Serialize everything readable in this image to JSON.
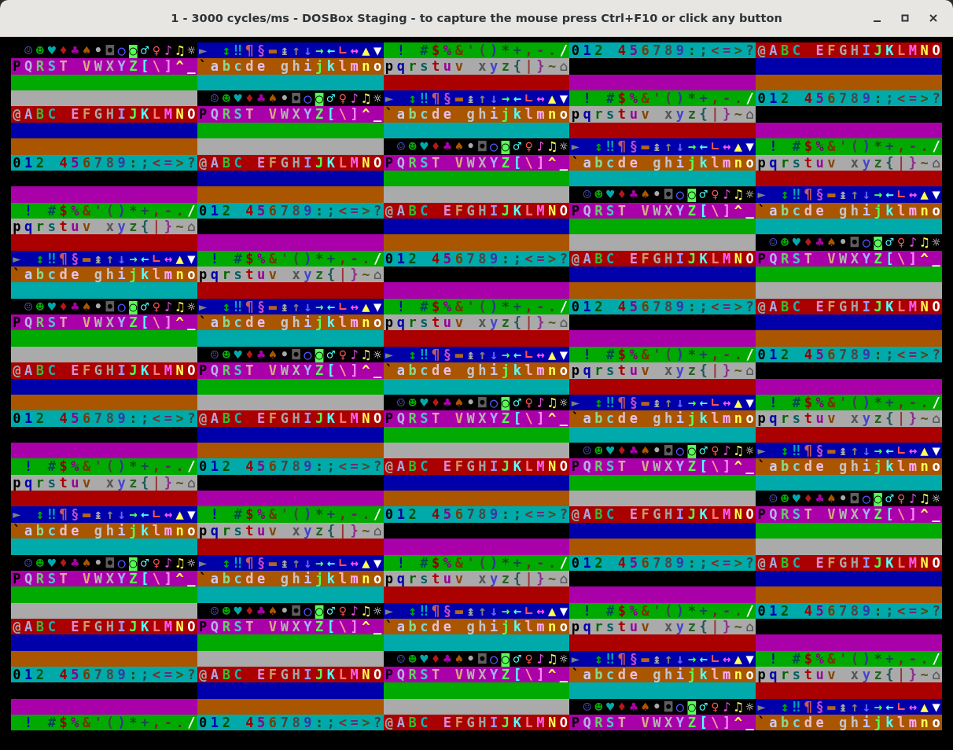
{
  "window": {
    "title": "1 - 3000 cycles/ms - DOSBox Staging - to capture the mouse press Ctrl+F10 or click any button"
  },
  "screen": {
    "rows": [
      [
        {
          "text": " ☺☻♥♦♣♠•◘○◙♂♀♪♫☼",
          "color": "#000000"
        },
        {
          "text": "► ↕‼¶§▬↨↑↓→←∟↔▲▼",
          "color": "#0000aa"
        },
        {
          "text": " ! #$%&'()*+,-./",
          "color": "#00aa00"
        },
        {
          "text": "012 456789:;<=>?",
          "color": "#00aaaa"
        },
        {
          "text": "@ABC EFGHIJKLMNO",
          "color": "#aa0000"
        }
      ],
      [
        {
          "text": "PQRST VWXYZ[\\]^_",
          "color": "#aa00aa"
        },
        {
          "text": "`abcde ghijklmno",
          "color": "#aa5500"
        },
        {
          "text": "pqrstuv xyz{|}~⌂",
          "color": "#aaaaaa"
        },
        {
          "color": "#000000"
        },
        {
          "color": "#0000aa"
        }
      ],
      [
        {
          "color": "#00aa00"
        },
        {
          "color": "#00aaaa"
        },
        {
          "color": "#aa0000"
        },
        {
          "color": "#aa00aa"
        },
        {
          "color": "#aa5500"
        }
      ],
      [
        {
          "color": "#aaaaaa"
        },
        {
          "text": " ☺☻♥♦♣♠•◘○◙♂♀♪♫☼",
          "color": "#000000"
        },
        {
          "text": "► ↕‼¶§▬↨↑↓→←∟↔▲▼",
          "color": "#0000aa"
        },
        {
          "text": " ! #$%&'()*+,-./",
          "color": "#00aa00"
        },
        {
          "text": "012 456789:;<=>?",
          "color": "#00aaaa"
        }
      ],
      [
        {
          "text": "@ABC EFGHIJKLMNO",
          "color": "#aa0000"
        },
        {
          "text": "PQRST VWXYZ[\\]^_",
          "color": "#aa00aa"
        },
        {
          "text": "`abcde ghijklmno",
          "color": "#aa5500"
        },
        {
          "text": "pqrstuv xyz{|}~⌂",
          "color": "#aaaaaa"
        },
        {
          "color": "#000000"
        }
      ],
      [
        {
          "color": "#0000aa"
        },
        {
          "color": "#00aa00"
        },
        {
          "color": "#00aaaa"
        },
        {
          "color": "#aa0000"
        },
        {
          "color": "#aa00aa"
        }
      ],
      [
        {
          "color": "#aa5500"
        },
        {
          "color": "#aaaaaa"
        },
        {
          "text": " ☺☻♥♦♣♠•◘○◙♂♀♪♫☼",
          "color": "#000000"
        },
        {
          "text": "► ↕‼¶§▬↨↑↓→←∟↔▲▼",
          "color": "#0000aa"
        },
        {
          "text": " ! #$%&'()*+,-./",
          "color": "#00aa00"
        }
      ],
      [
        {
          "text": "012 456789:;<=>?",
          "color": "#00aaaa"
        },
        {
          "text": "@ABC EFGHIJKLMNO",
          "color": "#aa0000"
        },
        {
          "text": "PQRST VWXYZ[\\]^_",
          "color": "#aa00aa"
        },
        {
          "text": "`abcde ghijklmno",
          "color": "#aa5500"
        },
        {
          "text": "pqrstuv xyz{|}~⌂",
          "color": "#aaaaaa"
        }
      ],
      [
        {
          "color": "#000000"
        },
        {
          "color": "#0000aa"
        },
        {
          "color": "#00aa00"
        },
        {
          "color": "#00aaaa"
        },
        {
          "color": "#aa0000"
        }
      ],
      [
        {
          "color": "#aa00aa"
        },
        {
          "color": "#aa5500"
        },
        {
          "color": "#aaaaaa"
        },
        {
          "text": " ☺☻♥♦♣♠•◘○◙♂♀♪♫☼",
          "color": "#000000"
        },
        {
          "text": "► ↕‼¶§▬↨↑↓→←∟↔▲▼",
          "color": "#0000aa"
        }
      ],
      [
        {
          "text": " ! #$%&'()*+,-./",
          "color": "#00aa00"
        },
        {
          "text": "012 456789:;<=>?",
          "color": "#00aaaa"
        },
        {
          "text": "@ABC EFGHIJKLMNO",
          "color": "#aa0000"
        },
        {
          "text": "PQRST VWXYZ[\\]^_",
          "color": "#aa00aa"
        },
        {
          "text": "`abcde ghijklmno",
          "color": "#aa5500"
        }
      ],
      [
        {
          "text": "pqrstuv xyz{|}~⌂",
          "color": "#aaaaaa"
        },
        {
          "color": "#000000"
        },
        {
          "color": "#0000aa"
        },
        {
          "color": "#00aa00"
        },
        {
          "color": "#00aaaa"
        }
      ],
      [
        {
          "color": "#aa0000"
        },
        {
          "color": "#aa00aa"
        },
        {
          "color": "#aa5500"
        },
        {
          "color": "#aaaaaa"
        },
        {
          "text": " ☺☻♥♦♣♠•◘○◙♂♀♪♫☼",
          "color": "#000000"
        }
      ],
      [
        {
          "text": "► ↕‼¶§▬↨↑↓→←∟↔▲▼",
          "color": "#0000aa"
        },
        {
          "text": " ! #$%&'()*+,-./",
          "color": "#00aa00"
        },
        {
          "text": "012 456789:;<=>?",
          "color": "#00aaaa"
        },
        {
          "text": "@ABC EFGHIJKLMNO",
          "color": "#aa0000"
        },
        {
          "text": "PQRST VWXYZ[\\]^_",
          "color": "#aa00aa"
        }
      ],
      [
        {
          "text": "`abcde ghijklmno",
          "color": "#aa5500"
        },
        {
          "text": "pqrstuv xyz{|}~⌂",
          "color": "#aaaaaa"
        },
        {
          "color": "#000000"
        },
        {
          "color": "#0000aa"
        },
        {
          "color": "#00aa00"
        }
      ],
      [
        {
          "color": "#00aaaa"
        },
        {
          "color": "#aa0000"
        },
        {
          "color": "#aa00aa"
        },
        {
          "color": "#aa5500"
        },
        {
          "color": "#aaaaaa"
        }
      ],
      [
        {
          "text": " ☺☻♥♦♣♠•◘○◙♂♀♪♫☼",
          "color": "#000000"
        },
        {
          "text": "► ↕‼¶§▬↨↑↓→←∟↔▲▼",
          "color": "#0000aa"
        },
        {
          "text": " ! #$%&'()*+,-./",
          "color": "#00aa00"
        },
        {
          "text": "012 456789:;<=>?",
          "color": "#00aaaa"
        },
        {
          "text": "@ABC EFGHIJKLMNO",
          "color": "#aa0000"
        }
      ],
      [
        {
          "text": "PQRST VWXYZ[\\]^_",
          "color": "#aa00aa"
        },
        {
          "text": "`abcde ghijklmno",
          "color": "#aa5500"
        },
        {
          "text": "pqrstuv xyz{|}~⌂",
          "color": "#aaaaaa"
        },
        {
          "color": "#000000"
        },
        {
          "color": "#0000aa"
        }
      ],
      [
        {
          "color": "#00aa00"
        },
        {
          "color": "#00aaaa"
        },
        {
          "color": "#aa0000"
        },
        {
          "color": "#aa00aa"
        },
        {
          "color": "#aa5500"
        }
      ],
      [
        {
          "color": "#aaaaaa"
        },
        {
          "text": " ☺☻♥♦♣♠•◘○◙♂♀♪♫☼",
          "color": "#000000"
        },
        {
          "text": "► ↕‼¶§▬↨↑↓→←∟↔▲▼",
          "color": "#0000aa"
        },
        {
          "text": " ! #$%&'()*+,-./",
          "color": "#00aa00"
        },
        {
          "text": "012 456789:;<=>?",
          "color": "#00aaaa"
        }
      ],
      [
        {
          "text": "@ABC EFGHIJKLMNO",
          "color": "#aa0000"
        },
        {
          "text": "PQRST VWXYZ[\\]^_",
          "color": "#aa00aa"
        },
        {
          "text": "`abcde ghijklmno",
          "color": "#aa5500"
        },
        {
          "text": "pqrstuv xyz{|}~⌂",
          "color": "#aaaaaa"
        },
        {
          "color": "#000000"
        }
      ],
      [
        {
          "color": "#0000aa"
        },
        {
          "color": "#00aa00"
        },
        {
          "color": "#00aaaa"
        },
        {
          "color": "#aa0000"
        },
        {
          "color": "#aa00aa"
        }
      ],
      [
        {
          "color": "#aa5500"
        },
        {
          "color": "#aaaaaa"
        },
        {
          "text": " ☺☻♥♦♣♠•◘○◙♂♀♪♫☼",
          "color": "#000000"
        },
        {
          "text": "► ↕‼¶§▬↨↑↓→←∟↔▲▼",
          "color": "#0000aa"
        },
        {
          "text": " ! #$%&'()*+,-./",
          "color": "#00aa00"
        }
      ],
      [
        {
          "text": "012 456789:;<=>?",
          "color": "#00aaaa"
        },
        {
          "text": "@ABC EFGHIJKLMNO",
          "color": "#aa0000"
        },
        {
          "text": "PQRST VWXYZ[\\]^_",
          "color": "#aa00aa"
        },
        {
          "text": "`abcde ghijklmno",
          "color": "#aa5500"
        },
        {
          "text": "pqrstuv xyz{|}~⌂",
          "color": "#aaaaaa"
        }
      ],
      [
        {
          "color": "#000000"
        },
        {
          "color": "#0000aa"
        },
        {
          "color": "#00aa00"
        },
        {
          "color": "#00aaaa"
        },
        {
          "color": "#aa0000"
        }
      ],
      [
        {
          "color": "#aa00aa"
        },
        {
          "color": "#aa5500"
        },
        {
          "color": "#aaaaaa"
        },
        {
          "text": " ☺☻♥♦♣♠•◘○◙♂♀♪♫☼",
          "color": "#000000"
        },
        {
          "text": "► ↕‼¶§▬↨↑↓→←∟↔▲▼",
          "color": "#0000aa"
        }
      ],
      [
        {
          "text": " ! #$%&'()*+,-./",
          "color": "#00aa00"
        },
        {
          "text": "012 456789:;<=>?",
          "color": "#00aaaa"
        },
        {
          "text": "@ABC EFGHIJKLMNO",
          "color": "#aa0000"
        },
        {
          "text": "PQRST VWXYZ[\\]^_",
          "color": "#aa00aa"
        },
        {
          "text": "`abcde ghijklmno",
          "color": "#aa5500"
        }
      ],
      [
        {
          "text": "pqrstuv xyz{|}~⌂",
          "color": "#aaaaaa"
        },
        {
          "color": "#000000"
        },
        {
          "color": "#0000aa"
        },
        {
          "color": "#00aa00"
        },
        {
          "color": "#00aaaa"
        }
      ],
      [
        {
          "color": "#aa0000"
        },
        {
          "color": "#aa00aa"
        },
        {
          "color": "#aa5500"
        },
        {
          "color": "#aaaaaa"
        },
        {
          "text": " ☺☻♥♦♣♠•◘○◙♂♀♪♫☼",
          "color": "#000000"
        }
      ],
      [
        {
          "text": "► ↕‼¶§▬↨↑↓→←∟↔▲▼",
          "color": "#0000aa"
        },
        {
          "text": " ! #$%&'()*+,-./",
          "color": "#00aa00"
        },
        {
          "text": "012 456789:;<=>?",
          "color": "#00aaaa"
        },
        {
          "text": "@ABC EFGHIJKLMNO",
          "color": "#aa0000"
        },
        {
          "text": "PQRST VWXYZ[\\]^_",
          "color": "#aa00aa"
        }
      ],
      [
        {
          "text": "`abcde ghijklmno",
          "color": "#aa5500"
        },
        {
          "text": "pqrstuv xyz{|}~⌂",
          "color": "#aaaaaa"
        },
        {
          "color": "#000000"
        },
        {
          "color": "#0000aa"
        },
        {
          "color": "#00aa00"
        }
      ],
      [
        {
          "color": "#00aaaa"
        },
        {
          "color": "#aa0000"
        },
        {
          "color": "#aa00aa"
        },
        {
          "color": "#aa5500"
        },
        {
          "color": "#aaaaaa"
        }
      ],
      [
        {
          "text": " ☺☻♥♦♣♠•◘○◙♂♀♪♫☼",
          "color": "#000000"
        },
        {
          "text": "► ↕‼¶§▬↨↑↓→←∟↔▲▼",
          "color": "#0000aa"
        },
        {
          "text": " ! #$%&'()*+,-./",
          "color": "#00aa00"
        },
        {
          "text": "012 456789:;<=>?",
          "color": "#00aaaa"
        },
        {
          "text": "@ABC EFGHIJKLMNO",
          "color": "#aa0000"
        }
      ],
      [
        {
          "text": "PQRST VWXYZ[\\]^_",
          "color": "#aa00aa"
        },
        {
          "text": "`abcde ghijklmno",
          "color": "#aa5500"
        },
        {
          "text": "pqrstuv xyz{|}~⌂",
          "color": "#aaaaaa"
        },
        {
          "color": "#000000"
        },
        {
          "color": "#0000aa"
        }
      ],
      [
        {
          "color": "#00aa00"
        },
        {
          "color": "#00aaaa"
        },
        {
          "color": "#aa0000"
        },
        {
          "color": "#aa00aa"
        },
        {
          "color": "#aa5500"
        }
      ],
      [
        {
          "color": "#aaaaaa"
        },
        {
          "text": " ☺☻♥♦♣♠•◘○◙♂♀♪♫☼",
          "color": "#000000"
        },
        {
          "text": "► ↕‼¶§▬↨↑↓→←∟↔▲▼",
          "color": "#0000aa"
        },
        {
          "text": " ! #$%&'()*+,-./",
          "color": "#00aa00"
        },
        {
          "text": "012 456789:;<=>?",
          "color": "#00aaaa"
        }
      ],
      [
        {
          "text": "@ABC EFGHIJKLMNO",
          "color": "#aa0000"
        },
        {
          "text": "PQRST VWXYZ[\\]^_",
          "color": "#aa00aa"
        },
        {
          "text": "`abcde ghijklmno",
          "color": "#aa5500"
        },
        {
          "text": "pqrstuv xyz{|}~⌂",
          "color": "#aaaaaa"
        },
        {
          "color": "#000000"
        }
      ],
      [
        {
          "color": "#0000aa"
        },
        {
          "color": "#00aa00"
        },
        {
          "color": "#00aaaa"
        },
        {
          "color": "#aa0000"
        },
        {
          "color": "#aa00aa"
        }
      ],
      [
        {
          "color": "#aa5500"
        },
        {
          "color": "#aaaaaa"
        },
        {
          "text": " ☺☻♥♦♣♠•◘○◙♂♀♪♫☼",
          "color": "#000000"
        },
        {
          "text": "► ↕‼¶§▬↨↑↓→←∟↔▲▼",
          "color": "#0000aa"
        },
        {
          "text": " ! #$%&'()*+,-./",
          "color": "#00aa00"
        }
      ],
      [
        {
          "text": "012 456789:;<=>?",
          "color": "#00aaaa"
        },
        {
          "text": "@ABC EFGHIJKLMNO",
          "color": "#aa0000"
        },
        {
          "text": "PQRST VWXYZ[\\]^_",
          "color": "#aa00aa"
        },
        {
          "text": "`abcde ghijklmno",
          "color": "#aa5500"
        },
        {
          "text": "pqrstuv xyz{|}~⌂",
          "color": "#aaaaaa"
        }
      ],
      [
        {
          "color": "#000000"
        },
        {
          "color": "#0000aa"
        },
        {
          "color": "#00aa00"
        },
        {
          "color": "#00aaaa"
        },
        {
          "color": "#aa0000"
        }
      ],
      [
        {
          "color": "#aa00aa"
        },
        {
          "color": "#aa5500"
        },
        {
          "color": "#aaaaaa"
        },
        {
          "text": " ☺☻♥♦♣♠•◘○◙♂♀♪♫☼",
          "color": "#000000"
        },
        {
          "text": "► ↕‼¶§▬↨↑↓→←∟↔▲▼",
          "color": "#0000aa"
        }
      ],
      [
        {
          "text": " ! #$%&'()*+,-./",
          "color": "#00aa00"
        },
        {
          "text": "012 456789:;<=>?",
          "color": "#00aaaa"
        },
        {
          "text": "@ABC EFGHIJKLMNO",
          "color": "#aa0000"
        },
        {
          "text": "PQRST VWXYZ[\\]^_",
          "color": "#aa00aa"
        },
        {
          "text": "`abcde ghijklmno",
          "color": "#aa5500"
        }
      ]
    ]
  }
}
